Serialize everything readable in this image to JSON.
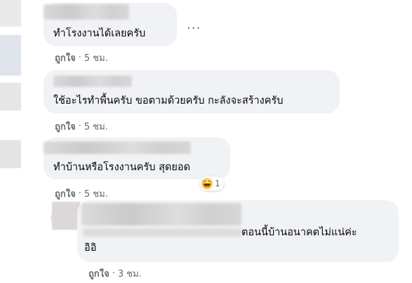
{
  "comments": [
    {
      "text": "ทำโรงงานได้เลยครับ",
      "like_label": "ถูกใจ",
      "separator": "·",
      "time": "5 ชม."
    },
    {
      "text": "ใช้อะไรทำพื้นครับ ขอตามด้วยครับ กะลังจะสร้างครับ",
      "like_label": "ถูกใจ",
      "separator": "·",
      "time": "5 ชม."
    },
    {
      "text": "ทำบ้านหรือโรงงานครับ สุดยอด",
      "like_label": "ถูกใจ",
      "separator": "·",
      "time": "5 ชม.",
      "reaction": {
        "icon": "haha-icon",
        "count": "1"
      }
    },
    {
      "text_line1": "ตอนนี้บ้านอนาคตไม่แน่ค่ะ",
      "text_line2": "อิอิ",
      "like_label": "ถูกใจ",
      "separator": "·",
      "time": "3 ชม."
    }
  ],
  "more_options": "···"
}
